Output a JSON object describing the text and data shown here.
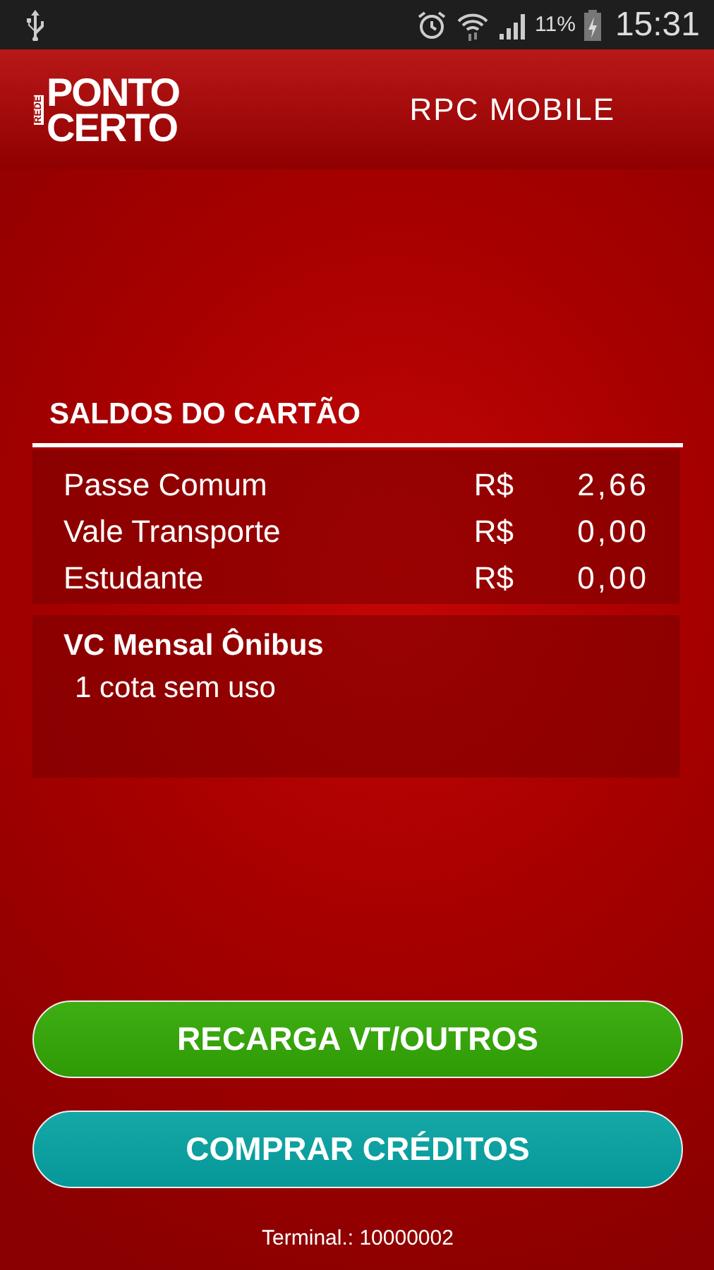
{
  "status_bar": {
    "battery": "11%",
    "time": "15:31"
  },
  "header": {
    "logo": {
      "top": "PONTO",
      "bottom": "CERTO",
      "side": "REDE"
    },
    "title": "RPC MOBILE"
  },
  "balances": {
    "title": "SALDOS DO CARTÃO",
    "rows": [
      {
        "label": "Passe Comum",
        "currency": "R$",
        "amount": "2,66"
      },
      {
        "label": "Vale Transporte",
        "currency": "R$",
        "amount": "0,00"
      },
      {
        "label": "Estudante",
        "currency": "R$",
        "amount": "0,00"
      }
    ]
  },
  "pass": {
    "title": "VC Mensal Ônibus",
    "detail": "1 cota sem uso"
  },
  "buttons": [
    {
      "label": "RECARGA VT/OUTROS",
      "kind": "recharge"
    },
    {
      "label": "COMPRAR CRÉDITOS",
      "kind": "buy"
    }
  ],
  "footer": {
    "terminal": "Terminal.: 10000002"
  }
}
